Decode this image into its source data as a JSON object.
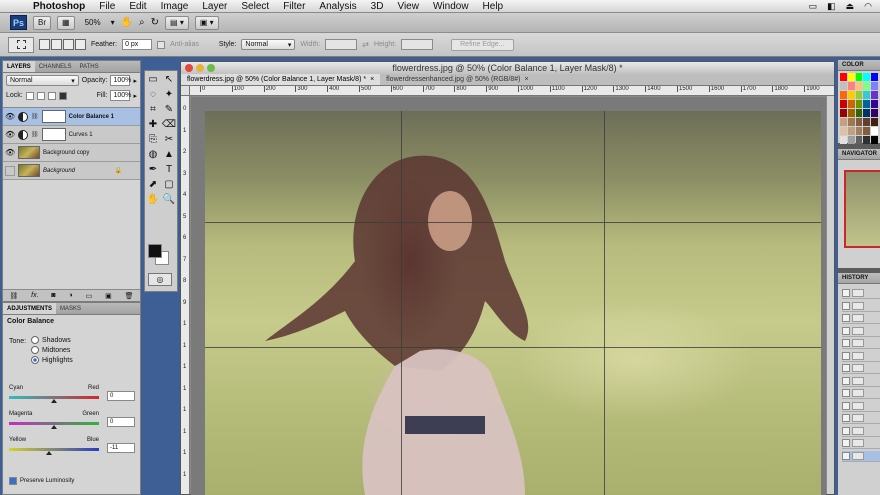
{
  "menubar": {
    "app": "Photoshop",
    "items": [
      "File",
      "Edit",
      "Image",
      "Layer",
      "Select",
      "Filter",
      "Analysis",
      "3D",
      "View",
      "Window",
      "Help"
    ]
  },
  "appbar": {
    "logo": "Ps",
    "br_label": "Br",
    "zoom": "50%",
    "icons": [
      "hand-icon",
      "zoom-icon",
      "rotate-icon",
      "arrange-icon",
      "screen-mode-icon"
    ]
  },
  "options": {
    "feather_label": "Feather:",
    "feather_value": "0 px",
    "antialias_label": "Anti-alias",
    "style_label": "Style:",
    "style_value": "Normal",
    "width_label": "Width:",
    "height_label": "Height:",
    "refine_edge": "Refine Edge..."
  },
  "layers_panel": {
    "tabs": [
      "LAYERS",
      "CHANNELS",
      "PATHS"
    ],
    "blend_mode": "Normal",
    "opacity_label": "Opacity:",
    "opacity_value": "100%",
    "lock_label": "Lock:",
    "fill_label": "Fill:",
    "fill_value": "100%",
    "layers": [
      {
        "name": "Color Balance 1",
        "kind": "adjustment",
        "selected": true
      },
      {
        "name": "Curves 1",
        "kind": "adjustment",
        "selected": false
      },
      {
        "name": "Background copy",
        "kind": "image",
        "selected": false
      },
      {
        "name": "Background",
        "kind": "image",
        "selected": false
      }
    ],
    "footer_icons": [
      "link-icon",
      "fx-icon",
      "mask-icon",
      "adjustment-icon",
      "group-icon",
      "new-layer-icon",
      "trash-icon"
    ],
    "footer_fx": "fx."
  },
  "adjustments_panel": {
    "tabs": [
      "ADJUSTMENTS",
      "MASKS"
    ],
    "title": "Color Balance",
    "tone_label": "Tone:",
    "tones": [
      {
        "label": "Shadows",
        "selected": false
      },
      {
        "label": "Midtones",
        "selected": false
      },
      {
        "label": "Highlights",
        "selected": true
      }
    ],
    "sliders": [
      {
        "left": "Cyan",
        "right": "Red",
        "value": "0",
        "position": 0.5,
        "gradient": [
          "#2fbcc0",
          "#d2282c"
        ]
      },
      {
        "left": "Magenta",
        "right": "Green",
        "value": "0",
        "position": 0.5,
        "gradient": [
          "#c42ec4",
          "#2eb43a"
        ]
      },
      {
        "left": "Yellow",
        "right": "Blue",
        "value": "-11",
        "position": 0.44,
        "gradient": [
          "#d6d22a",
          "#2a3cc4"
        ]
      }
    ],
    "preserve_label": "Preserve Luminosity"
  },
  "tools": [
    "▭",
    "↖",
    "◌",
    "✦",
    "⌗",
    "✎",
    "✚",
    "⌫",
    "⎘",
    "✂",
    "◍",
    "▲",
    "✒",
    "T",
    "⬈",
    "▢",
    "✋",
    "🔍"
  ],
  "document": {
    "title": "flowerdress.jpg @ 50% (Color Balance 1, Layer Mask/8) *",
    "tabs": [
      {
        "label": "flowerdress.jpg @ 50% (Color Balance 1, Layer Mask/8) *",
        "active": true
      },
      {
        "label": "flowerdressenhanced.jpg @ 50% (RGB/8#)",
        "active": false
      }
    ],
    "ruler_h": [
      "0",
      "100",
      "200",
      "300",
      "400",
      "500",
      "600",
      "700",
      "800",
      "900",
      "1000",
      "1100",
      "1200",
      "1300",
      "1400",
      "1500",
      "1600",
      "1700",
      "1800",
      "1900"
    ],
    "ruler_v": [
      "0",
      "1",
      "2",
      "3",
      "4",
      "5",
      "6",
      "7",
      "8",
      "9",
      "1",
      "1",
      "1",
      "1",
      "1",
      "1",
      "1",
      "1"
    ]
  },
  "right_panels": {
    "color_tab": "COLOR",
    "navigator_tab": "NAVIGATOR",
    "history_tab": "HISTORY",
    "swatches": [
      "#ff0000",
      "#ffff00",
      "#00ff00",
      "#00ffff",
      "#0000ff",
      "#c0c0c0",
      "#ff8080",
      "#ffc080",
      "#80ff80",
      "#8080ff",
      "#ff6600",
      "#ffcc00",
      "#99cc33",
      "#33cccc",
      "#6633cc",
      "#cc0000",
      "#cc6600",
      "#669900",
      "#006699",
      "#330099",
      "#990000",
      "#996600",
      "#336600",
      "#003366",
      "#330066",
      "#c8a080",
      "#a07850",
      "#806040",
      "#604030",
      "#402010",
      "#e0c0a0",
      "#c0a080",
      "#a08060",
      "#806040",
      "#ffffff",
      "#e0e0e0",
      "#a0a0a0",
      "#606060",
      "#303030",
      "#000000"
    ]
  }
}
